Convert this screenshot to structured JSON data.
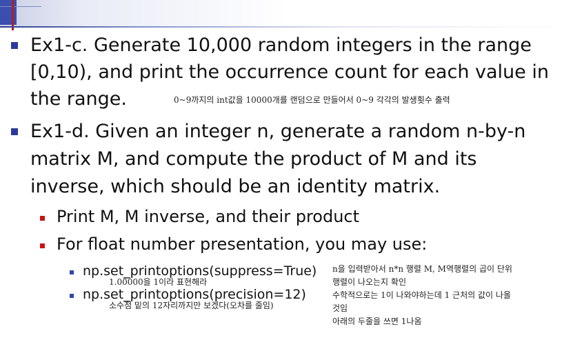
{
  "colors": {
    "bullet_level1": "#2a3a99",
    "bullet_level2": "#cc1111",
    "bullet_level3": "#3344aa",
    "header_accent": "#3a4fb0"
  },
  "slide": {
    "bullet1": {
      "lines": [
        "Ex1-c. Generate 10,000 random integers in the range",
        "[0,10), and print the occurrence count for each value in",
        "the range."
      ],
      "note": "0~9까지의 int값을 10000개를 랜덤으로 만들어서 0~9 각각의 발생횟수 출력"
    },
    "bullet2": {
      "lines": [
        "Ex1-d. Given an integer n, generate a random n-by-n",
        "matrix M, and compute the product of M and its",
        "inverse, which should be an identity matrix."
      ],
      "sub_items": [
        "Print M, M inverse, and their product",
        "For float number presentation, you may use:"
      ],
      "code_items": [
        "np.set_printoptions(suppress=True)",
        "np.set_printoptions(precision=12)"
      ],
      "code_notes": [
        "1.00000을 1이라 표현해라",
        "소수점 밑의 12자리까지만 보겠다(오차를 줄임)"
      ],
      "side_note_lines": [
        "n을 입력받아서 n*n 행렬 M, M역행렬의 곱이 단위",
        "행렬이 나오는지 확인",
        "수학적으로는 1이 나와야하는데 1 근처의 값이 나올",
        "것임",
        "아래의 두줄을 쓰면 1나옴"
      ]
    }
  }
}
